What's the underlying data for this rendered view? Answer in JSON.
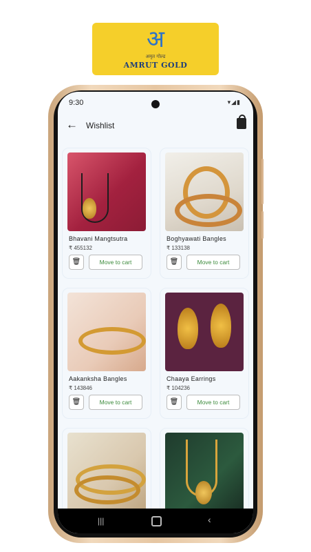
{
  "brand": {
    "glyph": "अ",
    "tagline": "अमृत गोल्ड",
    "name": "AMRUT GOLD"
  },
  "status": {
    "time": "9:30",
    "icons": "▾◢▮"
  },
  "appbar": {
    "title": "Wishlist"
  },
  "products": [
    {
      "name": "Bhavani Mangtsutra",
      "price": "₹ 455132",
      "action": "Move to cart"
    },
    {
      "name": "Boghyawati Bangles",
      "price": "₹ 133138",
      "action": "Move to cart"
    },
    {
      "name": "Aakanksha Bangles",
      "price": "₹ 143846",
      "action": "Move to cart"
    },
    {
      "name": "Chaaya Earrings",
      "price": "₹ 104236",
      "action": "Move to cart"
    },
    {
      "name": "",
      "price": "",
      "action": ""
    },
    {
      "name": "",
      "price": "",
      "action": ""
    }
  ],
  "icons": {
    "back": "back-arrow-icon",
    "bag": "shopping-bag-icon",
    "trash": "trash-icon",
    "recent": "recent-apps-icon",
    "home": "home-icon",
    "navback": "back-chevron-icon"
  }
}
